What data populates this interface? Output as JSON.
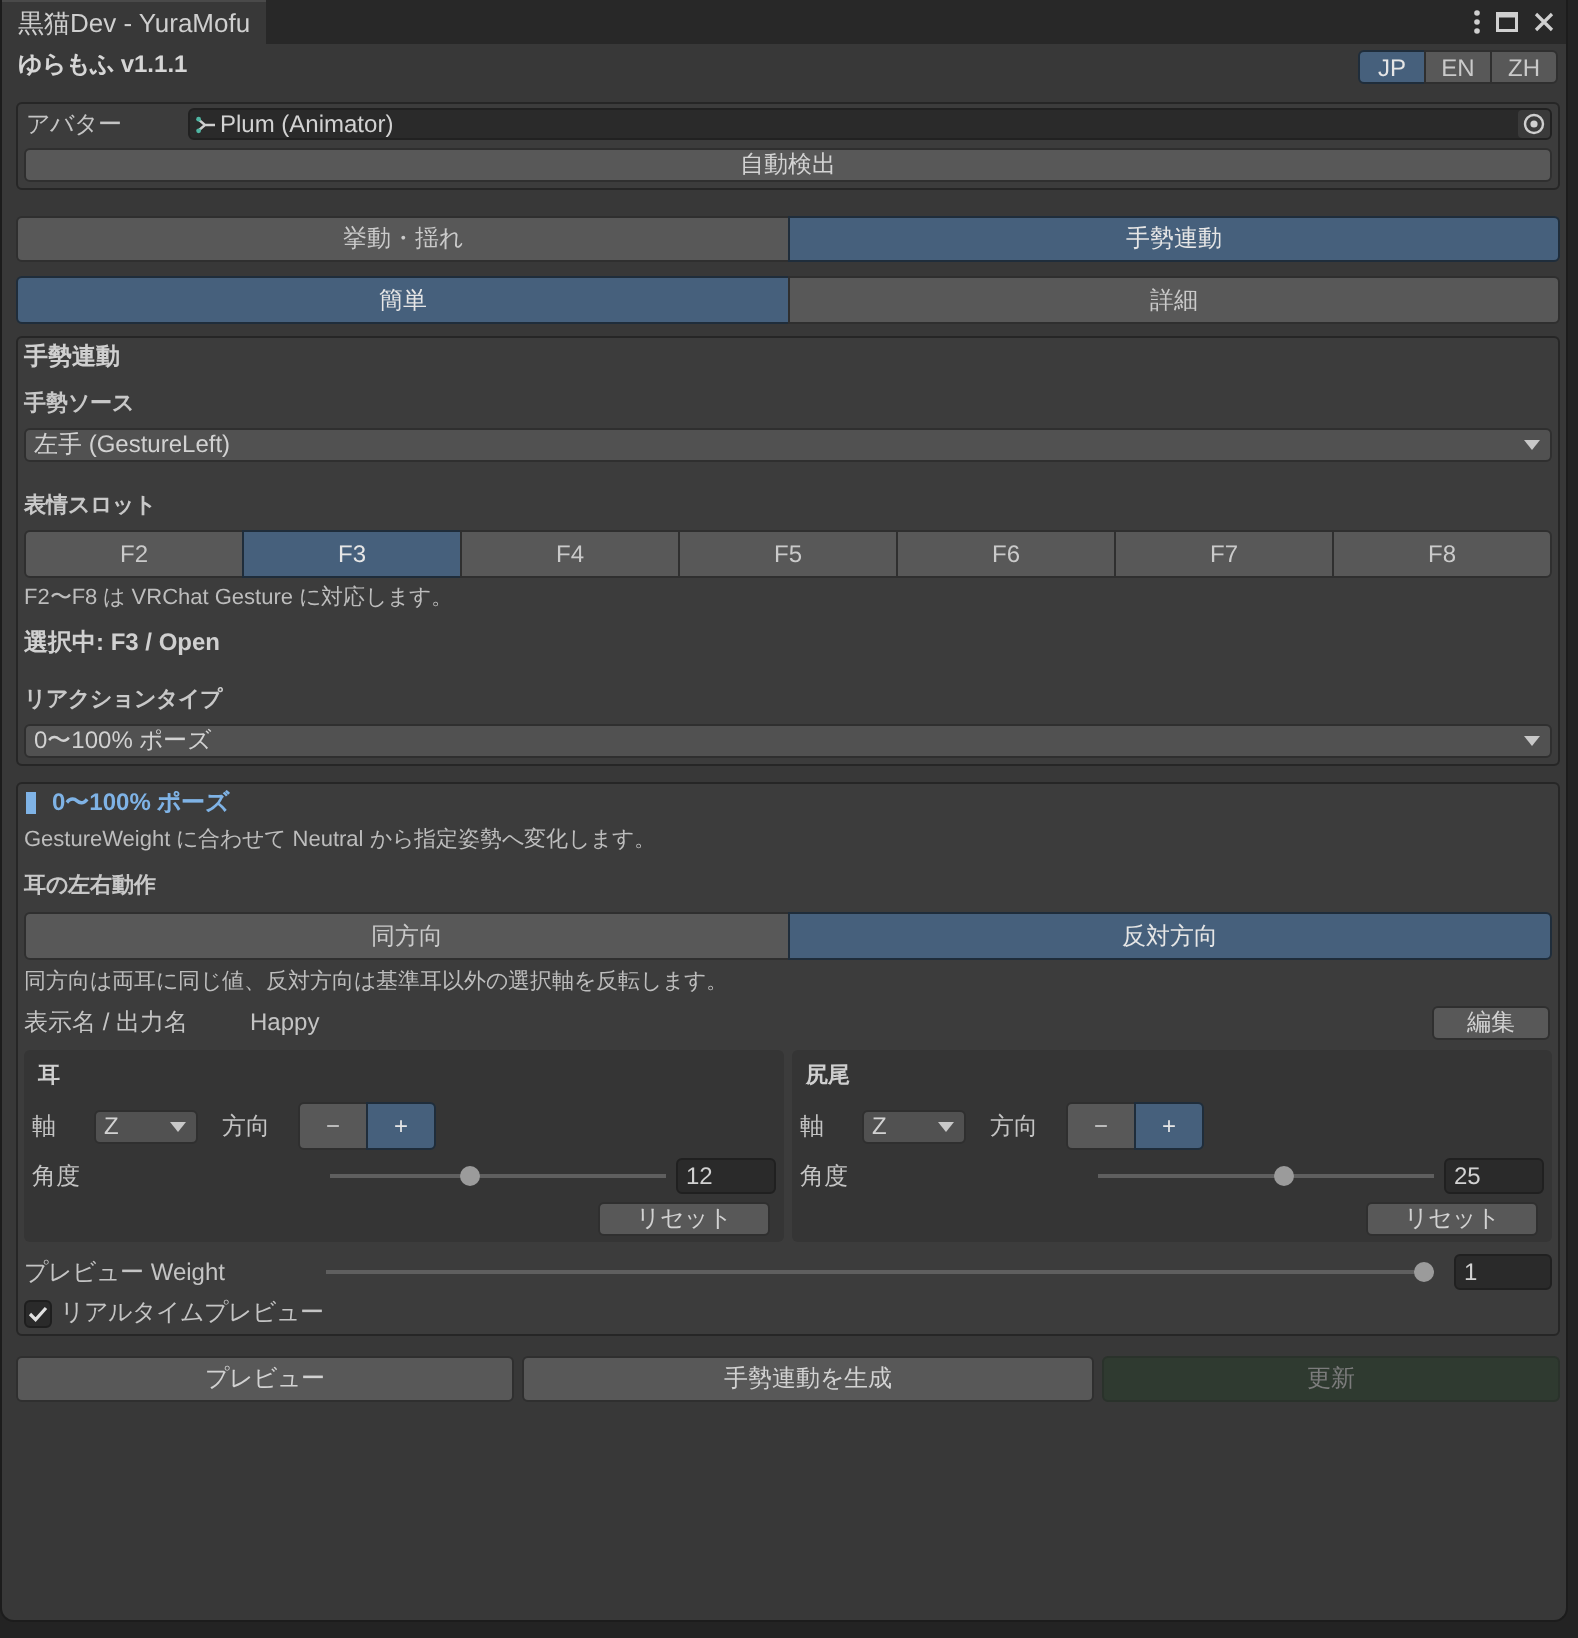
{
  "window": {
    "tab_title": "黒猫Dev - YuraMofu"
  },
  "header": {
    "title": "ゆらもふ v1.1.1",
    "languages": [
      {
        "label": "JP",
        "selected": true
      },
      {
        "label": "EN",
        "selected": false
      },
      {
        "label": "ZH",
        "selected": false
      }
    ]
  },
  "avatar": {
    "label": "アバター",
    "value": "Plum (Animator)",
    "auto_detect_button": "自動検出"
  },
  "main_tabs": [
    {
      "label": "挙動・揺れ",
      "selected": false
    },
    {
      "label": "手勢連動",
      "selected": true
    }
  ],
  "mode_tabs": [
    {
      "label": "簡単",
      "selected": true
    },
    {
      "label": "詳細",
      "selected": false
    }
  ],
  "gesture_section": {
    "title": "手勢連動",
    "source_label": "手勢ソース",
    "source_value": "左手 (GestureLeft)",
    "slot_label": "表情スロット",
    "slots": [
      {
        "label": "F2",
        "selected": false
      },
      {
        "label": "F3",
        "selected": true
      },
      {
        "label": "F4",
        "selected": false
      },
      {
        "label": "F5",
        "selected": false
      },
      {
        "label": "F6",
        "selected": false
      },
      {
        "label": "F7",
        "selected": false
      },
      {
        "label": "F8",
        "selected": false
      }
    ],
    "slot_note": "F2〜F8 は VRChat Gesture に対応します。",
    "selection": "選択中: F3 / Open",
    "reaction_label": "リアクションタイプ",
    "reaction_value": "0〜100% ポーズ"
  },
  "pose_section": {
    "title": "0〜100% ポーズ",
    "description": "GestureWeight に合わせて Neutral から指定姿勢へ変化します。",
    "ear_mode_label": "耳の左右動作",
    "ear_modes": [
      {
        "label": "同方向",
        "selected": false
      },
      {
        "label": "反対方向",
        "selected": true
      }
    ],
    "ear_mode_note": "同方向は両耳に同じ値、反対方向は基準耳以外の選択軸を反転します。",
    "display_name_label": "表示名 / 出力名",
    "display_name_value": "Happy",
    "edit_button": "編集",
    "parts": [
      {
        "title": "耳",
        "axis_label": "軸",
        "axis_value": "Z",
        "direction_label": "方向",
        "directions": [
          {
            "label": "−",
            "selected": false
          },
          {
            "label": "+",
            "selected": true
          }
        ],
        "angle_label": "角度",
        "level": 0.41,
        "angle_value": "12",
        "reset_button": "リセット"
      },
      {
        "title": "尻尾",
        "axis_label": "軸",
        "axis_value": "Z",
        "direction_label": "方向",
        "directions": [
          {
            "label": "−",
            "selected": false
          },
          {
            "label": "+",
            "selected": true
          }
        ],
        "angle_label": "角度",
        "level": 0.56,
        "angle_value": "25",
        "reset_button": "リセット"
      }
    ],
    "preview_weight": {
      "label": "プレビュー Weight",
      "level": 1,
      "value": "1"
    },
    "realtime_preview": {
      "label": "リアルタイムプレビュー",
      "checked": true
    }
  },
  "actions": [
    {
      "label": "プレビュー",
      "disabled": false
    },
    {
      "label": "手勢連動を生成",
      "disabled": false
    },
    {
      "label": "更新",
      "disabled": true
    }
  ]
}
